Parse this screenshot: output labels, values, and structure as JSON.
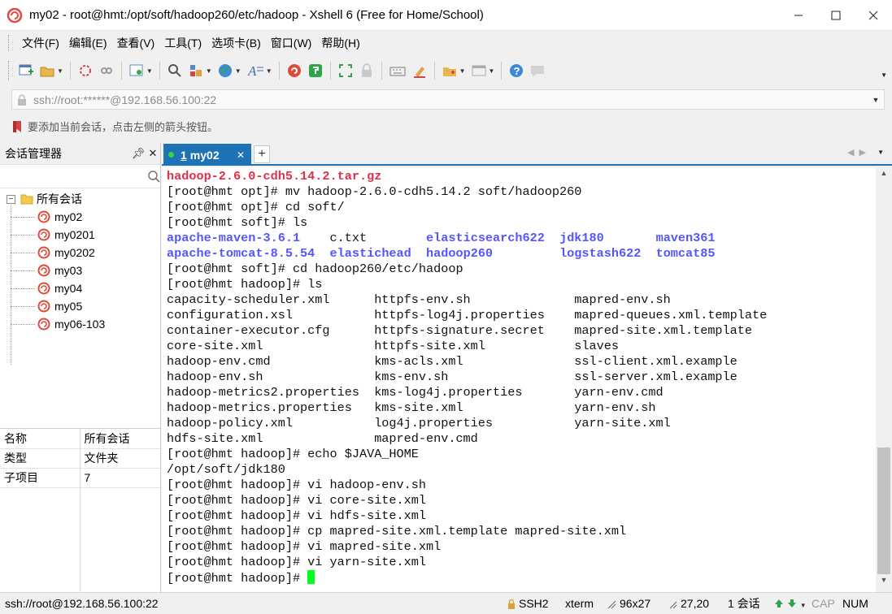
{
  "window": {
    "title": "my02 - root@hmt:/opt/soft/hadoop260/etc/hadoop - Xshell 6 (Free for Home/School)"
  },
  "menu": [
    "文件(F)",
    "编辑(E)",
    "查看(V)",
    "工具(T)",
    "选项卡(B)",
    "窗口(W)",
    "帮助(H)"
  ],
  "address": {
    "value": "ssh://root:******@192.168.56.100:22"
  },
  "hint": {
    "text": "要添加当前会话，点击左侧的箭头按钮。"
  },
  "session_manager": {
    "title": "会话管理器",
    "root": "所有会话",
    "sessions": [
      "my02",
      "my0201",
      "my0202",
      "my03",
      "my04",
      "my05",
      "my06-103"
    ]
  },
  "properties": [
    {
      "key": "名称",
      "value": "所有会话"
    },
    {
      "key": "类型",
      "value": "文件夹"
    },
    {
      "key": "子项目",
      "value": "7"
    }
  ],
  "tab": {
    "number": "1",
    "name": "my02"
  },
  "terminal": {
    "lines": [
      [
        {
          "t": "hadoop-2.6.0-cdh5.14.2.tar.gz",
          "c": "red"
        }
      ],
      [
        {
          "t": "[root@hmt opt]# mv hadoop-2.6.0-cdh5.14.2 soft/hadoop260"
        }
      ],
      [
        {
          "t": "[root@hmt opt]# cd soft/"
        }
      ],
      [
        {
          "t": "[root@hmt soft]# ls"
        }
      ],
      [
        {
          "t": "apache-maven-3.6.1",
          "c": "blue"
        },
        {
          "t": "    c.txt        "
        },
        {
          "t": "elasticsearch622",
          "c": "blue"
        },
        {
          "t": "  "
        },
        {
          "t": "jdk180",
          "c": "blue"
        },
        {
          "t": "       "
        },
        {
          "t": "maven361",
          "c": "blue"
        }
      ],
      [
        {
          "t": "apache-tomcat-8.5.54",
          "c": "blue"
        },
        {
          "t": "  "
        },
        {
          "t": "elastichead",
          "c": "blue"
        },
        {
          "t": "  "
        },
        {
          "t": "hadoop260",
          "c": "blue"
        },
        {
          "t": "         "
        },
        {
          "t": "logstash622",
          "c": "blue"
        },
        {
          "t": "  "
        },
        {
          "t": "tomcat85",
          "c": "blue"
        }
      ],
      [
        {
          "t": "[root@hmt soft]# cd hadoop260/etc/hadoop"
        }
      ],
      [
        {
          "t": "[root@hmt hadoop]# ls"
        }
      ],
      [
        {
          "t": "capacity-scheduler.xml      httpfs-env.sh              mapred-env.sh"
        }
      ],
      [
        {
          "t": "configuration.xsl           httpfs-log4j.properties    mapred-queues.xml.template"
        }
      ],
      [
        {
          "t": "container-executor.cfg      httpfs-signature.secret    mapred-site.xml.template"
        }
      ],
      [
        {
          "t": "core-site.xml               httpfs-site.xml            slaves"
        }
      ],
      [
        {
          "t": "hadoop-env.cmd              kms-acls.xml               ssl-client.xml.example"
        }
      ],
      [
        {
          "t": "hadoop-env.sh               kms-env.sh                 ssl-server.xml.example"
        }
      ],
      [
        {
          "t": "hadoop-metrics2.properties  kms-log4j.properties       yarn-env.cmd"
        }
      ],
      [
        {
          "t": "hadoop-metrics.properties   kms-site.xml               yarn-env.sh"
        }
      ],
      [
        {
          "t": "hadoop-policy.xml           log4j.properties           yarn-site.xml"
        }
      ],
      [
        {
          "t": "hdfs-site.xml               mapred-env.cmd"
        }
      ],
      [
        {
          "t": "[root@hmt hadoop]# echo $JAVA_HOME"
        }
      ],
      [
        {
          "t": "/opt/soft/jdk180"
        }
      ],
      [
        {
          "t": "[root@hmt hadoop]# vi hadoop-env.sh"
        }
      ],
      [
        {
          "t": "[root@hmt hadoop]# vi core-site.xml"
        }
      ],
      [
        {
          "t": "[root@hmt hadoop]# vi hdfs-site.xml"
        }
      ],
      [
        {
          "t": "[root@hmt hadoop]# cp mapred-site.xml.template mapred-site.xml"
        }
      ],
      [
        {
          "t": "[root@hmt hadoop]# vi mapred-site.xml"
        }
      ],
      [
        {
          "t": "[root@hmt hadoop]# vi yarn-site.xml"
        }
      ],
      [
        {
          "t": "[root@hmt hadoop]# "
        }
      ]
    ]
  },
  "status": {
    "connection": "ssh://root@192.168.56.100:22",
    "protocol": "SSH2",
    "term": "xterm",
    "size": "96x27",
    "position": "27,20",
    "sessions": "1 会话",
    "cap": "CAP",
    "num": "NUM"
  },
  "colors": {
    "accent": "#1e73b7",
    "terminal_red": "#e0314a",
    "terminal_blue": "#5555ff",
    "cursor": "#00ff1e"
  },
  "icons": {
    "app": "xshell-spiral-icon",
    "session": "xshell-spiral-icon",
    "folder": "folder-icon",
    "search": "search-icon",
    "lock": "lock-icon",
    "bookmark": "bookmark-icon"
  }
}
